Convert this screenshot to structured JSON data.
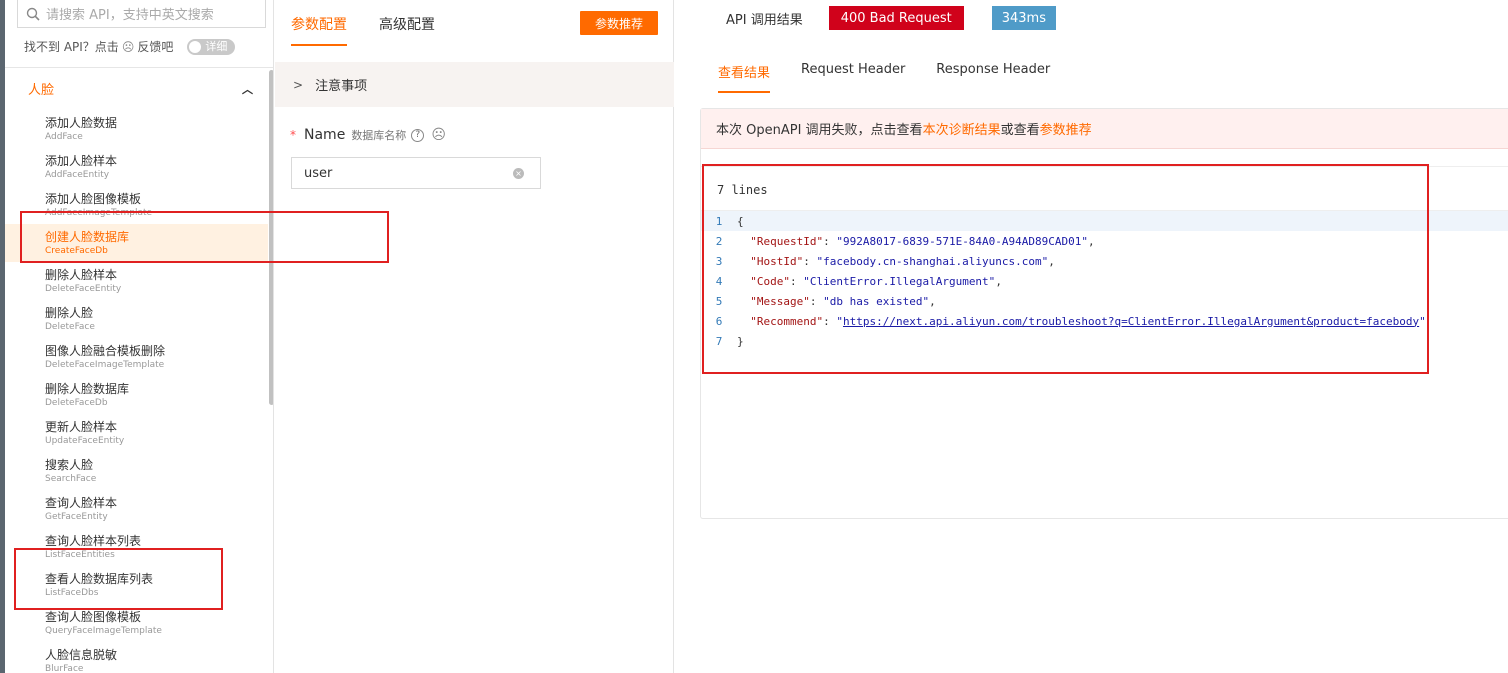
{
  "sidebar": {
    "search_placeholder": "请搜索 API，支持中英文搜索",
    "help_text_1": "找不到 API？点击",
    "help_face": "☹",
    "help_text_2": "反馈吧",
    "toggle_label": "详细",
    "group_label": "人脸",
    "group_chevron": "^",
    "items": [
      {
        "cn": "添加人脸数据",
        "en": "AddFace",
        "active": false
      },
      {
        "cn": "添加人脸样本",
        "en": "AddFaceEntity",
        "active": false
      },
      {
        "cn": "添加人脸图像模板",
        "en": "AddFaceImageTemplate",
        "active": false
      },
      {
        "cn": "创建人脸数据库",
        "en": "CreateFaceDb",
        "active": true
      },
      {
        "cn": "删除人脸样本",
        "en": "DeleteFaceEntity",
        "active": false
      },
      {
        "cn": "删除人脸",
        "en": "DeleteFace",
        "active": false
      },
      {
        "cn": "图像人脸融合模板删除",
        "en": "DeleteFaceImageTemplate",
        "active": false
      },
      {
        "cn": "删除人脸数据库",
        "en": "DeleteFaceDb",
        "active": false
      },
      {
        "cn": "更新人脸样本",
        "en": "UpdateFaceEntity",
        "active": false
      },
      {
        "cn": "搜索人脸",
        "en": "SearchFace",
        "active": false
      },
      {
        "cn": "查询人脸样本",
        "en": "GetFaceEntity",
        "active": false
      },
      {
        "cn": "查询人脸样本列表",
        "en": "ListFaceEntities",
        "active": false
      },
      {
        "cn": "查看人脸数据库列表",
        "en": "ListFaceDbs",
        "active": false
      },
      {
        "cn": "查询人脸图像模板",
        "en": "QueryFaceImageTemplate",
        "active": false
      },
      {
        "cn": "人脸信息脱敏",
        "en": "BlurFace",
        "active": false
      }
    ]
  },
  "middle": {
    "tabs": [
      {
        "label": "参数配置",
        "active": true
      },
      {
        "label": "高级配置",
        "active": false
      }
    ],
    "recommend_button": "参数推荐",
    "notice_arrow": ">",
    "notice_label": "注意事项",
    "field": {
      "required_mark": "*",
      "name": "Name",
      "description": "数据库名称",
      "help_icon": "?",
      "feedback_face": "☹",
      "value": "user",
      "clear_icon": "×"
    }
  },
  "result": {
    "title": "API 调用结果",
    "status": "400 Bad Request",
    "time": "343ms",
    "tabs": [
      {
        "label": "查看结果",
        "active": true
      },
      {
        "label": "Request Header",
        "active": false
      },
      {
        "label": "Response Header",
        "active": false
      }
    ],
    "alert": {
      "prefix": "本次 OpenAPI 调用失败，点击查看",
      "link1": "本次诊断结果",
      "middle": "或查看",
      "link2": "参数推荐"
    },
    "lines_label": "7 lines",
    "code_lines": [
      {
        "num": "1",
        "parts": [
          [
            "p",
            "{"
          ]
        ]
      },
      {
        "num": "2",
        "parts": [
          [
            "p",
            "  "
          ],
          [
            "k",
            "\"RequestId\""
          ],
          [
            "p",
            ": "
          ],
          [
            "s",
            "\"992A8017-6839-571E-84A0-A94AD89CAD01\""
          ],
          [
            "p",
            ","
          ]
        ]
      },
      {
        "num": "3",
        "parts": [
          [
            "p",
            "  "
          ],
          [
            "k",
            "\"HostId\""
          ],
          [
            "p",
            ": "
          ],
          [
            "s",
            "\"facebody.cn-shanghai.aliyuncs.com\""
          ],
          [
            "p",
            ","
          ]
        ]
      },
      {
        "num": "4",
        "parts": [
          [
            "p",
            "  "
          ],
          [
            "k",
            "\"Code\""
          ],
          [
            "p",
            ": "
          ],
          [
            "s",
            "\"ClientError.IllegalArgument\""
          ],
          [
            "p",
            ","
          ]
        ]
      },
      {
        "num": "5",
        "parts": [
          [
            "p",
            "  "
          ],
          [
            "k",
            "\"Message\""
          ],
          [
            "p",
            ": "
          ],
          [
            "s",
            "\"db has existed\""
          ],
          [
            "p",
            ","
          ]
        ]
      },
      {
        "num": "6",
        "parts": [
          [
            "p",
            "  "
          ],
          [
            "k",
            "\"Recommend\""
          ],
          [
            "p",
            ": "
          ],
          [
            "s",
            "\""
          ],
          [
            "u",
            "https://next.api.aliyun.com/troubleshoot?q=ClientError.IllegalArgument&product=facebody"
          ],
          [
            "s",
            "\""
          ]
        ]
      },
      {
        "num": "7",
        "parts": [
          [
            "p",
            "}"
          ]
        ]
      }
    ]
  },
  "colors": {
    "accent": "#ff6a00",
    "error_badge": "#d0021b",
    "time_badge": "#4f9bc8",
    "annotation": "#e02020"
  }
}
